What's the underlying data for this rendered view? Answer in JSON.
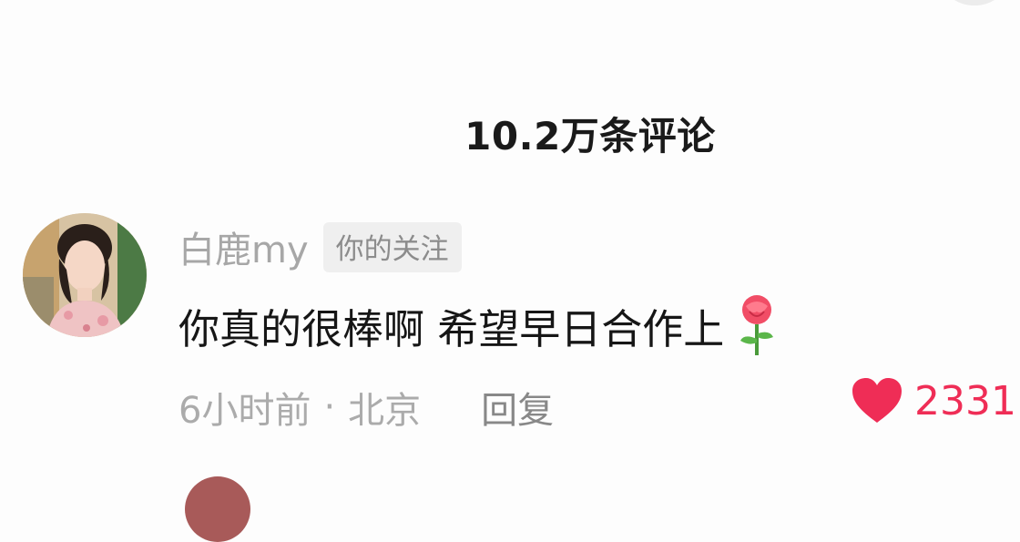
{
  "header": {
    "title": "10.2万条评论"
  },
  "comment": {
    "username": "白鹿my",
    "follow_badge": "你的关注",
    "text": "你真的很棒啊 希望早日合作上",
    "emoji_icon": "rose-icon",
    "meta": {
      "time": "6小时前",
      "separator": "·",
      "location": "北京"
    },
    "reply_label": "回复",
    "like_icon": "heart-icon",
    "like_count": "2331"
  },
  "colors": {
    "like_red": "#ef2d56",
    "username_gray": "#a7a7a7",
    "badge_bg": "#efefef",
    "text_dark": "#161616"
  }
}
